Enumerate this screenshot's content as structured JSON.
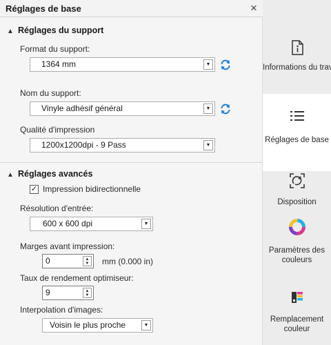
{
  "panel": {
    "title": "Réglages de base",
    "close_symbol": "×"
  },
  "support_section": {
    "title": "Réglages du support",
    "format_label": "Format du support:",
    "format_value": "1364 mm",
    "name_label": "Nom du support:",
    "name_value": "Vinyle adhésif général",
    "quality_label": "Qualité d'impression",
    "quality_value": "1200x1200dpi - 9 Pass"
  },
  "advanced_section": {
    "title": "Réglages avancés",
    "bidirectional_label": "Impression bidirectionnelle",
    "bidirectional_checked": true,
    "resolution_label": "Résolution d'entrée:",
    "resolution_value": "600 x 600 dpi",
    "margins_label": "Marges avant impression:",
    "margins_value": "0",
    "margins_unit": "mm  (0.000 in)",
    "optimizer_label": "Taux de rendement optimiseur:",
    "optimizer_value": "9",
    "interpolation_label": "Interpolation d'images:",
    "interpolation_value": "Voisin le plus proche"
  },
  "sidebar": {
    "tabs": [
      {
        "label": "Informations du travail",
        "icon": "info-icon"
      },
      {
        "label": "Réglages de base",
        "icon": "list-icon",
        "active": true
      },
      {
        "label": "Disposition",
        "icon": "layout-icon"
      },
      {
        "label": "Paramètres des couleurs",
        "icon": "color-ring-icon"
      },
      {
        "label": "Remplacement couleur",
        "icon": "color-replace-icon"
      }
    ]
  },
  "colors": {
    "accent_blue": "#1a7fd6",
    "active_tab_bg": "#ffffff",
    "sidebar_bg": "#ececec"
  }
}
